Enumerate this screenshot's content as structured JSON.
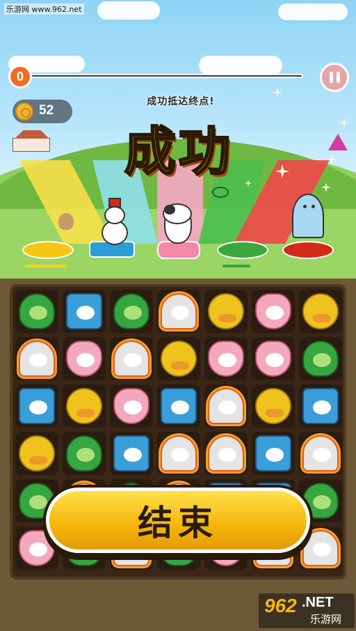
{
  "watermark_top": "乐游网 www.962.net",
  "progress": {
    "value_label": "0",
    "fraction": 0.0
  },
  "coins": {
    "value": "52"
  },
  "pause_icon": "pause-icon",
  "result": {
    "subtitle": "成功抵达终点!",
    "title": "成功"
  },
  "end_button": {
    "label": "结束"
  },
  "logo": {
    "brand": "962",
    "suffix": ".NET",
    "name": "乐游网"
  },
  "colors": {
    "accent": "#f36b21",
    "title": "#ffb400",
    "button": "#f6b80e",
    "board": "#3a2616"
  },
  "board": {
    "rows": [
      [
        "frog",
        "can",
        "frog",
        "ghost",
        "duck",
        "cat",
        "duck"
      ],
      [
        "ghost",
        "cat",
        "ghost",
        "duck",
        "cat",
        "cat",
        "frog"
      ],
      [
        "can",
        "duck",
        "cat",
        "can",
        "ghost",
        "duck",
        "can"
      ],
      [
        "duck",
        "frog",
        "can",
        "ghost",
        "ghost",
        "can",
        "ghost"
      ],
      [
        "frog",
        "ghost",
        "frog",
        "ghost",
        "can",
        "can",
        "frog"
      ],
      [
        "cat",
        "frog",
        "ghost",
        "frog",
        "cat",
        "ghost",
        "ghost"
      ]
    ]
  }
}
